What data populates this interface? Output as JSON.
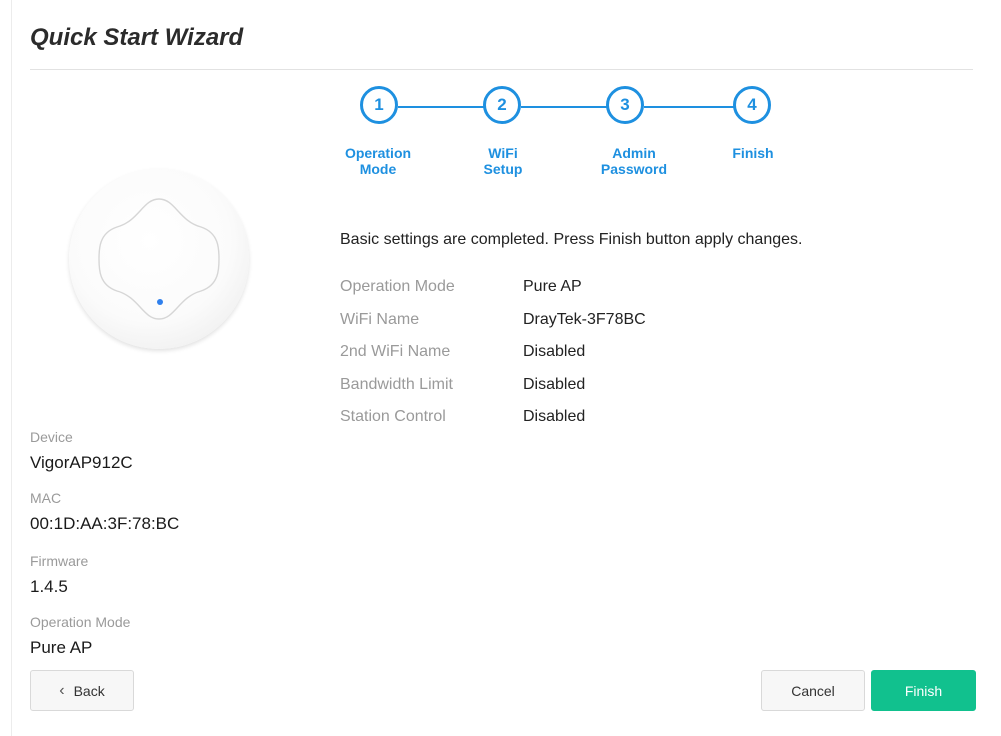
{
  "wizard": {
    "title": "Quick Start Wizard"
  },
  "steps": [
    {
      "number": "1",
      "label_line1": "Operation",
      "label_line2": "Mode"
    },
    {
      "number": "2",
      "label_line1": "WiFi",
      "label_line2": "Setup"
    },
    {
      "number": "3",
      "label_line1": "Admin",
      "label_line2": "Password"
    },
    {
      "number": "4",
      "label_line1": "Finish",
      "label_line2": ""
    }
  ],
  "device_info": {
    "device_label": "Device",
    "device_value": "VigorAP912C",
    "mac_label": "MAC",
    "mac_value": "00:1D:AA:3F:78:BC",
    "firmware_label": "Firmware",
    "firmware_value": "1.4.5",
    "mode_label": "Operation Mode",
    "mode_value": "Pure AP"
  },
  "summary": {
    "message": "Basic settings are completed. Press Finish button apply changes.",
    "rows": [
      {
        "label": "Operation Mode",
        "value": "Pure AP"
      },
      {
        "label": "WiFi Name",
        "value": "DrayTek-3F78BC"
      },
      {
        "label": "2nd WiFi Name",
        "value": "Disabled"
      },
      {
        "label": "Bandwidth Limit",
        "value": "Disabled"
      },
      {
        "label": "Station Control",
        "value": "Disabled"
      }
    ]
  },
  "buttons": {
    "back": "Back",
    "cancel": "Cancel",
    "finish": "Finish"
  },
  "colors": {
    "accent": "#1e90e0",
    "primary_button": "#11c18e",
    "device_led": "#2f80ed"
  },
  "icons": {
    "back": "chevron-left-icon"
  }
}
